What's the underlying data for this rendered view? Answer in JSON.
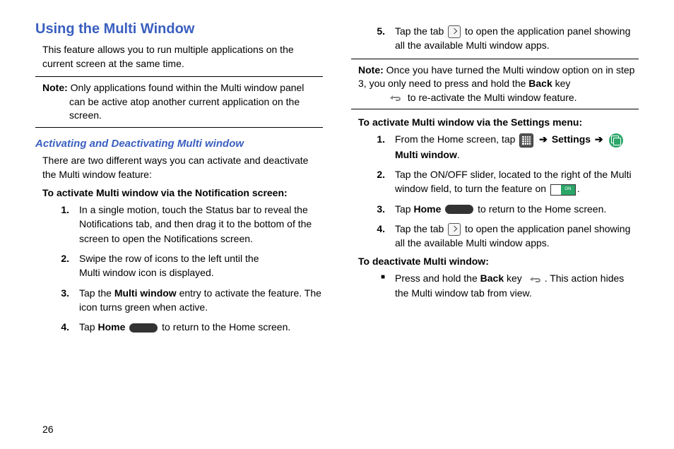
{
  "page_number": "26",
  "left": {
    "h1": "Using the Multi Window",
    "intro": "This feature allows you to run multiple applications on the current screen at the same time.",
    "note_label": "Note:",
    "note_text_line1": " Only applications found within the Multi window panel",
    "note_text_line2": "can be active atop another current application on the screen.",
    "h2": "Activating and Deactivating Multi window",
    "h2_intro": "There are two different ways you can activate and deactivate the Multi window feature:",
    "sub1": "To activate Multi window via the Notification screen:",
    "s1_num": "1.",
    "s1_text": "In a single motion, touch the Status bar to reveal the Notifications tab, and then drag it to the bottom of the screen to open the Notifications screen.",
    "s2_num": "2.",
    "s2_text_a": "Swipe the row of icons to the left until the",
    "s2_text_b": "Multi window icon is displayed.",
    "s3_num": "3.",
    "s3_a": "Tap the ",
    "s3_b": "Multi window",
    "s3_c": " entry to activate the feature. The icon turns green when active.",
    "s4_num": "4.",
    "s4_a": "Tap ",
    "s4_b": "Home",
    "s4_c": " to return to the Home screen."
  },
  "right": {
    "s5_num": "5.",
    "s5_a": "Tap the tab ",
    "s5_b": " to open the application panel showing all the available Multi window apps.",
    "note_label": "Note:",
    "note_a": " Once you have turned the Multi window option on in step 3, you only need to press and hold the ",
    "note_b": "Back",
    "note_c": " key ",
    "note_d": " to re-activate the Multi window feature.",
    "sub2": "To activate Multi window via the Settings menu:",
    "r1_num": "1.",
    "r1_a": "From the Home screen, tap ",
    "r1_arrow": " ➔ ",
    "r1_b": "Settings",
    "r1_c": "Multi window",
    "r1_d": ".",
    "r2_num": "2.",
    "r2_a": "Tap the ON/OFF slider, located to the right of the Multi window field, to turn the feature on  ",
    "r2_b": ".",
    "r3_num": "3.",
    "r3_a": "Tap ",
    "r3_b": "Home",
    "r3_c": " to return to the Home screen.",
    "r4_num": "4.",
    "r4_a": "Tap the tab ",
    "r4_b": " to open the application panel showing all the available Multi window apps.",
    "sub3": "To deactivate Multi window:",
    "b1_a": "Press and hold the ",
    "b1_b": "Back",
    "b1_c": " key ",
    "b1_d": ". This action hides the Multi window tab from view.",
    "toggle_label": "ON"
  }
}
